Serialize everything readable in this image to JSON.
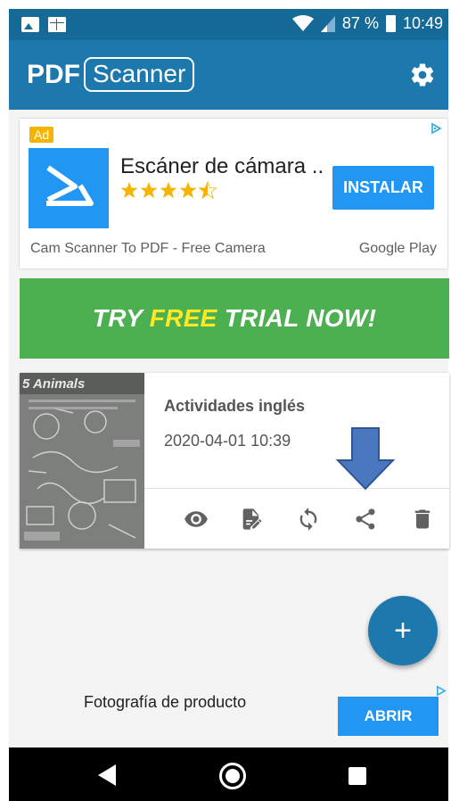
{
  "status_bar": {
    "battery": "87 %",
    "time": "10:49",
    "icons": [
      "image-notification-icon",
      "calendar-notification-icon",
      "wifi-icon",
      "signal-icon",
      "battery-icon"
    ]
  },
  "app_bar": {
    "logo_pdf": "PDF",
    "logo_scanner": "Scanner",
    "settings_icon": "gear-icon",
    "color": "#1c78ad"
  },
  "ad": {
    "badge": "Ad",
    "title": "Escáner de cámara ..",
    "rating_stars": 4.5,
    "install_label": "INSTALAR",
    "subtitle": "Cam Scanner To PDF - Free Camera",
    "store": "Google Play"
  },
  "trial_banner": {
    "text_before": "TRY ",
    "text_highlight": "FREE",
    "text_after": " TRIAL NOW!",
    "color": "#4caf50",
    "highlight_color": "#ffe927"
  },
  "document": {
    "thumbnail_text": "5 Animals",
    "title": "Actividades inglés",
    "date": "2020-04-01 10:39",
    "actions": [
      "view-icon",
      "edit-icon",
      "sync-icon",
      "share-icon",
      "delete-icon"
    ]
  },
  "fab": {
    "label": "+"
  },
  "bottom_ad": {
    "text": "Fotografía de producto",
    "button": "ABRIR"
  },
  "nav_bar": {
    "icons": [
      "back-icon",
      "home-icon",
      "recents-icon"
    ]
  }
}
